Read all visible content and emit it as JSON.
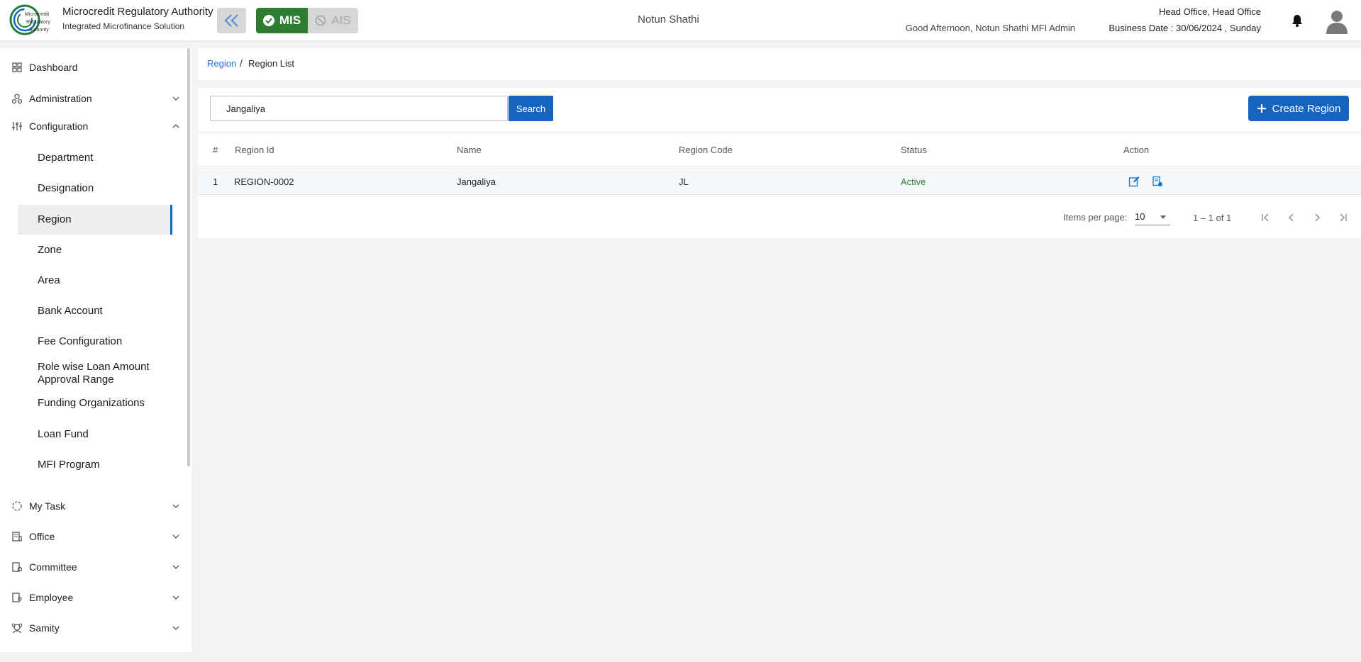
{
  "header": {
    "brand_title": "Microcredit Regulatory Authority",
    "brand_subtitle": "Integrated Microfinance Solution",
    "logo_text": [
      "Microcredit",
      "Regulatory",
      "Authority"
    ],
    "mis_label": "MIS",
    "ais_label": "AIS",
    "org_name": "Notun Shathi",
    "greeting": "Good Afternoon, Notun Shathi MFI Admin",
    "office": "Head Office, Head Office",
    "business_date": "Business Date : 30/06/2024 , Sunday",
    "accent_color": "#2e7d32"
  },
  "sidebar": {
    "top_items": [
      {
        "label": "Dashboard",
        "icon": "dashboard-grid-icon"
      },
      {
        "label": "Administration",
        "icon": "users-cog-icon"
      },
      {
        "label": "Configuration",
        "icon": "sliders-icon"
      }
    ],
    "config_items": [
      {
        "label": "Department"
      },
      {
        "label": "Designation"
      },
      {
        "label": "Region",
        "active": true
      },
      {
        "label": "Zone"
      },
      {
        "label": "Area"
      },
      {
        "label": "Bank Account"
      },
      {
        "label": "Fee Configuration"
      },
      {
        "label": "Role wise Loan Amount Approval Range"
      },
      {
        "label": "Funding Organizations"
      },
      {
        "label": "Loan Fund"
      },
      {
        "label": "MFI Program"
      }
    ],
    "bottom_items": [
      {
        "label": "My Task",
        "icon": "circle-dashed-icon"
      },
      {
        "label": "Office",
        "icon": "building-icon"
      },
      {
        "label": "Committee",
        "icon": "committee-icon"
      },
      {
        "label": "Employee",
        "icon": "employee-icon"
      },
      {
        "label": "Samity",
        "icon": "group-icon"
      }
    ]
  },
  "breadcrumb": {
    "parent": "Region",
    "separator": "/",
    "current": "Region List"
  },
  "toolbar": {
    "search_value": "Jangaliya",
    "search_label": "Search",
    "create_label": "Create Region"
  },
  "table": {
    "columns": [
      "#",
      "Region Id",
      "Name",
      "Region Code",
      "Status",
      "Action"
    ],
    "rows": [
      {
        "index": "1",
        "region_id": "REGION-0002",
        "name": "Jangaliya",
        "code": "JL",
        "status": "Active"
      }
    ]
  },
  "paginator": {
    "items_per_page_label": "Items per page:",
    "items_per_page": "10",
    "range": "1 – 1 of 1"
  },
  "colors": {
    "primary": "#1565c0",
    "success": "#2e7d32"
  }
}
